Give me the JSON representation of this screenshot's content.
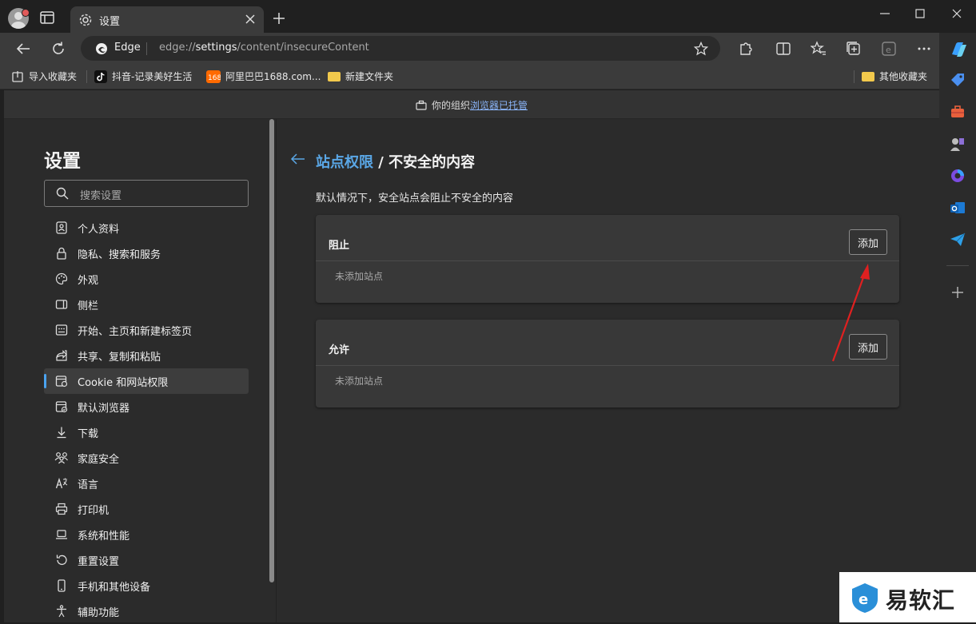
{
  "tab": {
    "title": "设置"
  },
  "address": {
    "site_label": "Edge",
    "url_prefix": "edge://",
    "url_host": "settings",
    "url_path": "/content/insecureContent"
  },
  "bookmarks": [
    {
      "label": "导入收藏夹"
    },
    {
      "label": "抖音-记录美好生活"
    },
    {
      "label": "阿里巴巴1688.com..."
    },
    {
      "label": "新建文件夹"
    }
  ],
  "bookmarks_other": "其他收藏夹",
  "managed": {
    "prefix": "你的组织",
    "link": "浏览器已托管"
  },
  "settings": {
    "title": "设置",
    "search_placeholder": "搜索设置",
    "nav": [
      {
        "label": "个人资料",
        "icon": "profile-icon"
      },
      {
        "label": "隐私、搜索和服务",
        "icon": "lock-icon"
      },
      {
        "label": "外观",
        "icon": "palette-icon"
      },
      {
        "label": "侧栏",
        "icon": "sidebar-icon"
      },
      {
        "label": "开始、主页和新建标签页",
        "icon": "home-grid-icon"
      },
      {
        "label": "共享、复制和粘贴",
        "icon": "share-icon"
      },
      {
        "label": "Cookie 和网站权限",
        "icon": "site-permissions-icon",
        "active": true
      },
      {
        "label": "默认浏览器",
        "icon": "default-browser-icon"
      },
      {
        "label": "下载",
        "icon": "download-icon"
      },
      {
        "label": "家庭安全",
        "icon": "family-icon"
      },
      {
        "label": "语言",
        "icon": "language-icon"
      },
      {
        "label": "打印机",
        "icon": "printer-icon"
      },
      {
        "label": "系统和性能",
        "icon": "laptop-icon"
      },
      {
        "label": "重置设置",
        "icon": "reset-icon"
      },
      {
        "label": "手机和其他设备",
        "icon": "phone-icon"
      },
      {
        "label": "辅助功能",
        "icon": "accessibility-icon"
      }
    ]
  },
  "content": {
    "breadcrumb_link": "站点权限",
    "breadcrumb_sep": " / ",
    "breadcrumb_current": "不安全的内容",
    "description": "默认情况下，安全站点会阻止不安全的内容",
    "block": {
      "title": "阻止",
      "add_label": "添加",
      "empty": "未添加站点"
    },
    "allow": {
      "title": "允许",
      "add_label": "添加",
      "empty": "未添加站点"
    }
  },
  "watermark": {
    "text": "易软汇"
  },
  "colors": {
    "accent": "#5aa7e6",
    "arrow": "#e02020"
  }
}
